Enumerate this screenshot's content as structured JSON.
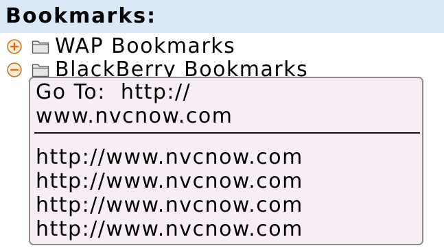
{
  "header": {
    "title": "Bookmarks:"
  },
  "tree": {
    "items": [
      {
        "label": "WAP Bookmarks",
        "expanded": false,
        "toggle_icon": "expand-plus-icon",
        "icon": "folder-icon"
      },
      {
        "label": "BlackBerry Bookmarks",
        "expanded": true,
        "toggle_icon": "collapse-minus-icon",
        "icon": "folder-icon"
      }
    ]
  },
  "popup": {
    "goto_field": {
      "label": "Go To:",
      "value_lines": [
        "http://",
        "www.nvcnow.com"
      ]
    },
    "history": [
      "http://www.nvcnow.com",
      "http://www.nvcnow.com",
      "http://www.nvcnow.com",
      "http://www.nvcnow.com"
    ]
  },
  "colors": {
    "header_bg": "#dbe8f8",
    "popup_bg": "#f7eef5",
    "popup_border": "#8c8c8c",
    "separator": "#111111",
    "toggle_ring": "#c9772f",
    "toggle_sign": "#d8701c",
    "toggle_fill": "#fdebd2",
    "folder_stroke": "#5c5c5c",
    "folder_fill": "#e6e6e6"
  }
}
